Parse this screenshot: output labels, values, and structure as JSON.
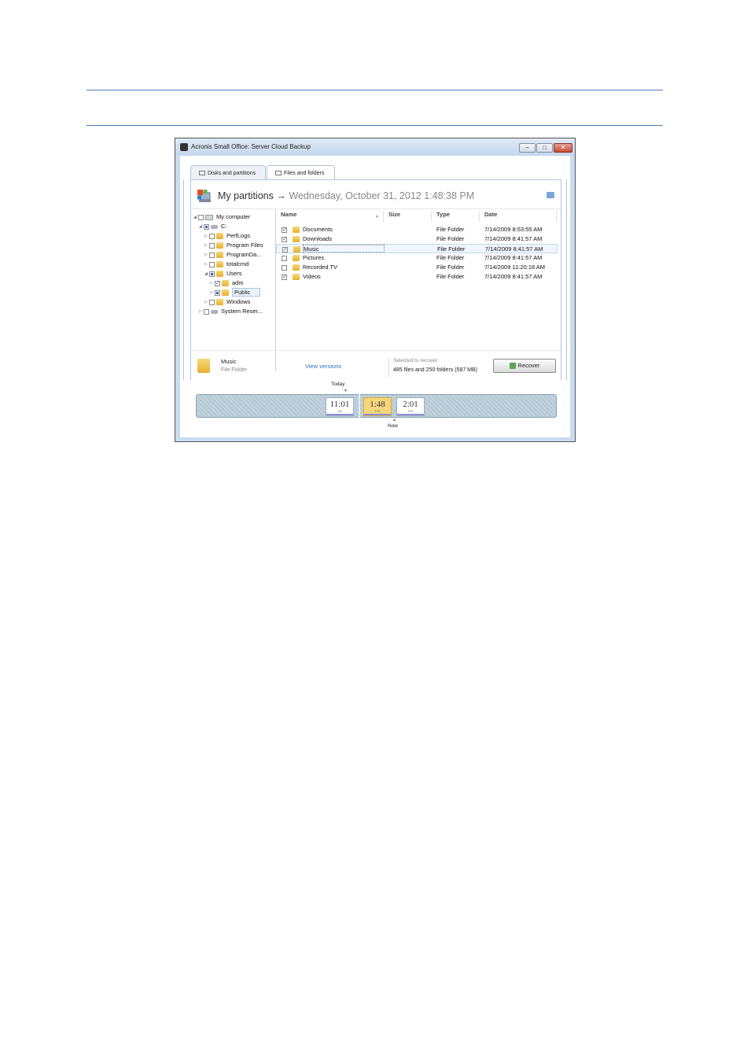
{
  "window": {
    "title": "Acronis Small Office: Server Cloud Backup",
    "controls": {
      "minimize": "–",
      "maximize": "□",
      "close": "✕"
    }
  },
  "tabs": [
    {
      "label": "Disks and partitions",
      "active": false
    },
    {
      "label": "Files and folders",
      "active": true
    }
  ],
  "header": {
    "title": "My partitions",
    "arrow": "→",
    "date": "Wednesday, October 31, 2012 1:48:38 PM"
  },
  "tree": {
    "my_computer": "My computer",
    "drive_c": "C:",
    "perflogs": "PerfLogs",
    "program_files": "Program Files",
    "programdata": "ProgramDa...",
    "totalcmd": "totalcmd",
    "users": "Users",
    "adm": "adm",
    "public": "Public",
    "windows": "Windows",
    "system_reserved": "System Reser..."
  },
  "columns": {
    "name": "Name",
    "size": "Size",
    "type": "Type",
    "date": "Date"
  },
  "rows": [
    {
      "name": "Documents",
      "size": "",
      "type": "File Folder",
      "date": "7/14/2009 8:53:55 AM",
      "checked": true
    },
    {
      "name": "Downloads",
      "size": "",
      "type": "File Folder",
      "date": "7/14/2009 8:41:57 AM",
      "checked": true
    },
    {
      "name": "Music",
      "size": "",
      "type": "File Folder",
      "date": "7/14/2009 8:41:57 AM",
      "checked": true
    },
    {
      "name": "Pictures",
      "size": "",
      "type": "File Folder",
      "date": "7/14/2009 8:41:57 AM",
      "checked": false
    },
    {
      "name": "Recorded TV",
      "size": "",
      "type": "File Folder",
      "date": "7/14/2009 11:20:18 AM",
      "checked": false
    },
    {
      "name": "Videos",
      "size": "",
      "type": "File Folder",
      "date": "7/14/2009 8:41:57 AM",
      "checked": true
    }
  ],
  "status": {
    "selected_name": "Music",
    "selected_type": "File Folder",
    "view_versions": "View versions",
    "selected_label": "Selected to recover:",
    "selected_value": "485 files and 250 folders (587 MB)",
    "recover_button": "Recover"
  },
  "timeline": {
    "today_label": "Today",
    "now_label": "Now",
    "slots": [
      {
        "time": "11:01",
        "ampm": "AM"
      },
      {
        "time": "1:48",
        "ampm": "PM"
      },
      {
        "time": "2:01",
        "ampm": "PM"
      }
    ]
  }
}
